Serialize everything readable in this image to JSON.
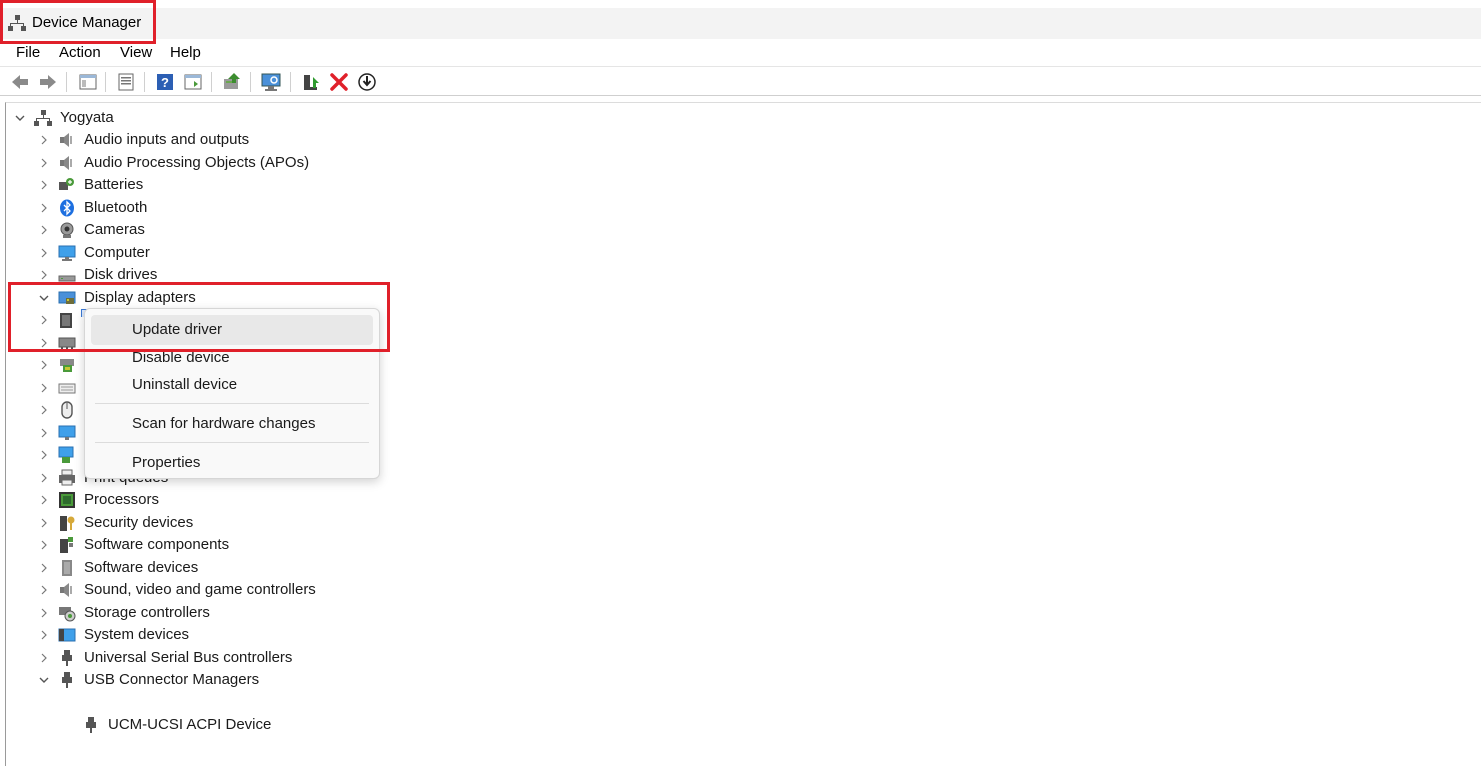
{
  "window": {
    "title": "Device Manager",
    "title_icon": "device-manager-icon"
  },
  "menu": [
    "File",
    "Action",
    "View",
    "Help"
  ],
  "toolbar": {
    "buttons": [
      "back-icon",
      "forward-icon",
      "show-hide-console-tree-icon",
      "properties-icon",
      "help-icon",
      "show-action-pane-icon",
      "update-driver-icon",
      "scan-hardware-icon",
      "enable-device-icon",
      "uninstall-device-icon",
      "disable-device-icon"
    ]
  },
  "tree": {
    "root": "Yogyata",
    "categories": [
      {
        "label": "Audio inputs and outputs",
        "icon": "speaker-icon",
        "expanded": false
      },
      {
        "label": "Audio Processing Objects (APOs)",
        "icon": "speaker-icon",
        "expanded": false
      },
      {
        "label": "Batteries",
        "icon": "battery-icon",
        "expanded": false
      },
      {
        "label": "Bluetooth",
        "icon": "bluetooth-icon",
        "expanded": false
      },
      {
        "label": "Cameras",
        "icon": "camera-icon",
        "expanded": false
      },
      {
        "label": "Computer",
        "icon": "computer-icon",
        "expanded": false
      },
      {
        "label": "Disk drives",
        "icon": "disk-drive-icon",
        "expanded": false
      },
      {
        "label": "Display adapters",
        "icon": "display-adapter-icon",
        "expanded": true
      },
      {
        "label": "",
        "icon": "firmware-icon",
        "expanded": false
      },
      {
        "label": "",
        "icon": "hid-icon",
        "expanded": false
      },
      {
        "label": "",
        "icon": "ide-controller-icon",
        "expanded": false
      },
      {
        "label": "",
        "icon": "keyboard-icon",
        "expanded": false
      },
      {
        "label": "",
        "icon": "mouse-icon",
        "expanded": false
      },
      {
        "label": "",
        "icon": "monitor-icon",
        "expanded": false
      },
      {
        "label": "Network adapters",
        "icon": "network-adapter-icon",
        "expanded": false
      },
      {
        "label": "Print queues",
        "icon": "printer-icon",
        "expanded": false
      },
      {
        "label": "Processors",
        "icon": "processor-icon",
        "expanded": false
      },
      {
        "label": "Security devices",
        "icon": "security-device-icon",
        "expanded": false
      },
      {
        "label": "Software components",
        "icon": "software-component-icon",
        "expanded": false
      },
      {
        "label": "Software devices",
        "icon": "software-device-icon",
        "expanded": false
      },
      {
        "label": "Sound, video and game controllers",
        "icon": "speaker-icon",
        "expanded": false
      },
      {
        "label": "Storage controllers",
        "icon": "storage-controller-icon",
        "expanded": false
      },
      {
        "label": "System devices",
        "icon": "system-device-icon",
        "expanded": false
      },
      {
        "label": "Universal Serial Bus controllers",
        "icon": "usb-icon",
        "expanded": false
      },
      {
        "label": "USB Connector Managers",
        "icon": "usb-icon",
        "expanded": true
      }
    ],
    "usb_child": "UCM-UCSI ACPI Device"
  },
  "context_menu": {
    "items": [
      "Update driver",
      "Disable device",
      "Uninstall device",
      "Scan for hardware changes",
      "Properties"
    ],
    "selected": "Update driver"
  },
  "colors": {
    "highlight": "#e0202a",
    "selection": "#3a78d4"
  }
}
